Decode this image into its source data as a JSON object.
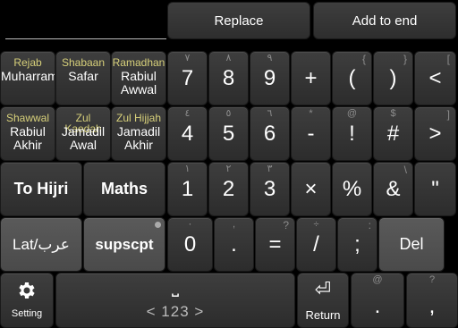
{
  "top_bar": {
    "replace_label": "Replace",
    "add_to_end_label": "Add to end"
  },
  "months": [
    {
      "top": "Rejab",
      "name": "Muharram"
    },
    {
      "top": "Shabaan",
      "name": "Safar"
    },
    {
      "top": "Ramadhan",
      "name": "Rabiul Awwal"
    },
    {
      "top": "Shawwal",
      "name": "Rabiul Akhir"
    },
    {
      "top": "Zul Kaedah",
      "name": "Jamadil Awal"
    },
    {
      "top": "Zul Hijjah",
      "name": "Jamadil Akhir"
    }
  ],
  "row1": [
    {
      "main": "7",
      "hint": "٧"
    },
    {
      "main": "8",
      "hint": "٨"
    },
    {
      "main": "9",
      "hint": "٩"
    },
    {
      "main": "+",
      "hint": ""
    },
    {
      "main": "(",
      "hint": "{"
    },
    {
      "main": ")",
      "hint": "}"
    },
    {
      "main": "<",
      "hint": "["
    }
  ],
  "row2": [
    {
      "main": "4",
      "hint": "٤"
    },
    {
      "main": "5",
      "hint": "٥"
    },
    {
      "main": "6",
      "hint": "٦"
    },
    {
      "main": "-",
      "hint": "*"
    },
    {
      "main": "!",
      "hint": "@"
    },
    {
      "main": "#",
      "hint": "$"
    },
    {
      "main": ">",
      "hint": "]"
    }
  ],
  "row3": [
    {
      "main": "1",
      "hint": "١"
    },
    {
      "main": "2",
      "hint": "٢"
    },
    {
      "main": "3",
      "hint": "٣"
    },
    {
      "main": "×",
      "hint": ""
    },
    {
      "main": "%",
      "hint": ""
    },
    {
      "main": "&",
      "hint": "\\"
    },
    {
      "main": "\"",
      "hint": ""
    }
  ],
  "row4": [
    {
      "main": "0",
      "hint": "٠"
    },
    {
      "main": ".",
      "hint": ","
    },
    {
      "main": "=",
      "hint": "?"
    },
    {
      "main": "/",
      "hint": "÷"
    },
    {
      "main": ";",
      "hint": ":"
    }
  ],
  "left_keys": {
    "to_hijri": "To Hijri",
    "maths": "Maths",
    "lat_arab": "Lat/عرب",
    "supscpt": "supscpt"
  },
  "bottom": {
    "setting_label": "Setting",
    "space_symbol": "⎵",
    "space_sub": "< 123 >",
    "return_label": "Return",
    "return_symbol": "⏎",
    "period_hint": "@",
    "period": ".",
    "comma_hint": "?",
    "comma": ","
  },
  "del_label": "Del"
}
